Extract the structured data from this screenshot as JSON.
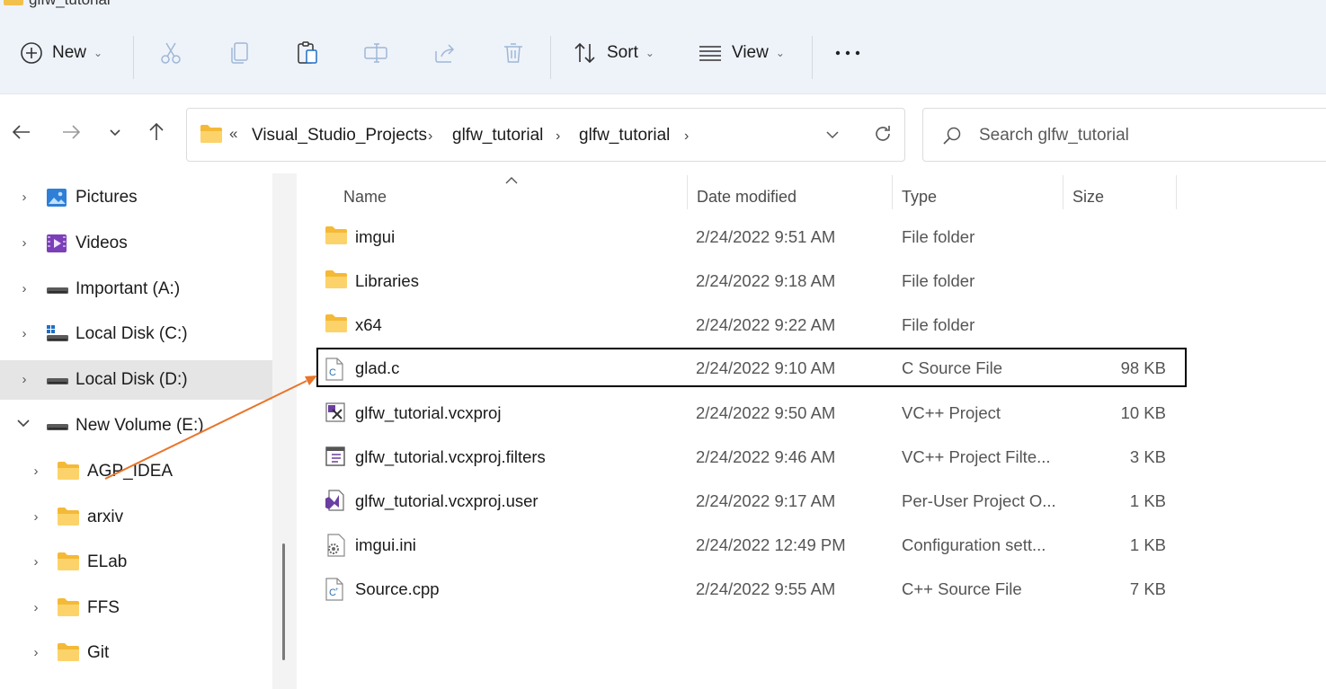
{
  "window": {
    "title": "glfw_tutorial"
  },
  "toolbar": {
    "new_label": "New",
    "sort_label": "Sort",
    "view_label": "View",
    "icons": [
      "plus-circle-icon",
      "cut-icon",
      "copy-icon",
      "paste-icon",
      "rename-icon",
      "share-icon",
      "delete-icon",
      "sort-icon",
      "view-icon",
      "more-icon"
    ]
  },
  "address": {
    "overflow": "«",
    "crumbs": [
      "Visual_Studio_Projects",
      "glfw_tutorial",
      "glfw_tutorial"
    ],
    "separator": "›"
  },
  "search": {
    "placeholder": "Search glfw_tutorial"
  },
  "nav": {
    "items": [
      {
        "label": "Pictures",
        "icon": "pictures-icon",
        "expanded": false,
        "selected": false
      },
      {
        "label": "Videos",
        "icon": "videos-icon",
        "expanded": false,
        "selected": false
      },
      {
        "label": "Important (A:)",
        "icon": "drive-icon",
        "expanded": false,
        "selected": false
      },
      {
        "label": "Local Disk (C:)",
        "icon": "windows-drive-icon",
        "expanded": false,
        "selected": false
      },
      {
        "label": "Local Disk (D:)",
        "icon": "drive-icon",
        "expanded": false,
        "selected": true
      },
      {
        "label": "New Volume (E:)",
        "icon": "drive-icon",
        "expanded": true,
        "selected": false
      },
      {
        "label": "AGP_IDEA",
        "icon": "folder-icon",
        "expanded": false,
        "selected": false
      },
      {
        "label": "arxiv",
        "icon": "folder-icon",
        "expanded": false,
        "selected": false
      },
      {
        "label": "ELab",
        "icon": "folder-icon",
        "expanded": false,
        "selected": false
      },
      {
        "label": "FFS",
        "icon": "folder-icon",
        "expanded": false,
        "selected": false
      },
      {
        "label": "Git",
        "icon": "folder-icon",
        "expanded": false,
        "selected": false
      }
    ]
  },
  "columns": {
    "name": "Name",
    "date": "Date modified",
    "type": "Type",
    "size": "Size"
  },
  "files": [
    {
      "name": "imgui",
      "date": "2/24/2022 9:51 AM",
      "type": "File folder",
      "size": "",
      "icon": "folder-icon"
    },
    {
      "name": "Libraries",
      "date": "2/24/2022 9:18 AM",
      "type": "File folder",
      "size": "",
      "icon": "folder-icon"
    },
    {
      "name": "x64",
      "date": "2/24/2022 9:22 AM",
      "type": "File folder",
      "size": "",
      "icon": "folder-icon"
    },
    {
      "name": "glad.c",
      "date": "2/24/2022 9:10 AM",
      "type": "C Source File",
      "size": "98 KB",
      "icon": "c-source-file-icon",
      "highlighted": true
    },
    {
      "name": "glfw_tutorial.vcxproj",
      "date": "2/24/2022 9:50 AM",
      "type": "VC++ Project",
      "size": "10 KB",
      "icon": "vcxproj-file-icon"
    },
    {
      "name": "glfw_tutorial.vcxproj.filters",
      "date": "2/24/2022 9:46 AM",
      "type": "VC++ Project Filte...",
      "size": "3 KB",
      "icon": "filters-file-icon"
    },
    {
      "name": "glfw_tutorial.vcxproj.user",
      "date": "2/24/2022 9:17 AM",
      "type": "Per-User Project O...",
      "size": "1 KB",
      "icon": "user-project-file-icon"
    },
    {
      "name": "imgui.ini",
      "date": "2/24/2022 12:49 PM",
      "type": "Configuration sett...",
      "size": "1 KB",
      "icon": "settings-file-icon"
    },
    {
      "name": "Source.cpp",
      "date": "2/24/2022 9:55 AM",
      "type": "C++ Source File",
      "size": "7 KB",
      "icon": "cpp-source-file-icon"
    }
  ],
  "annotation": {
    "arrow_color": "#e8752a",
    "box_color": "#000000"
  }
}
